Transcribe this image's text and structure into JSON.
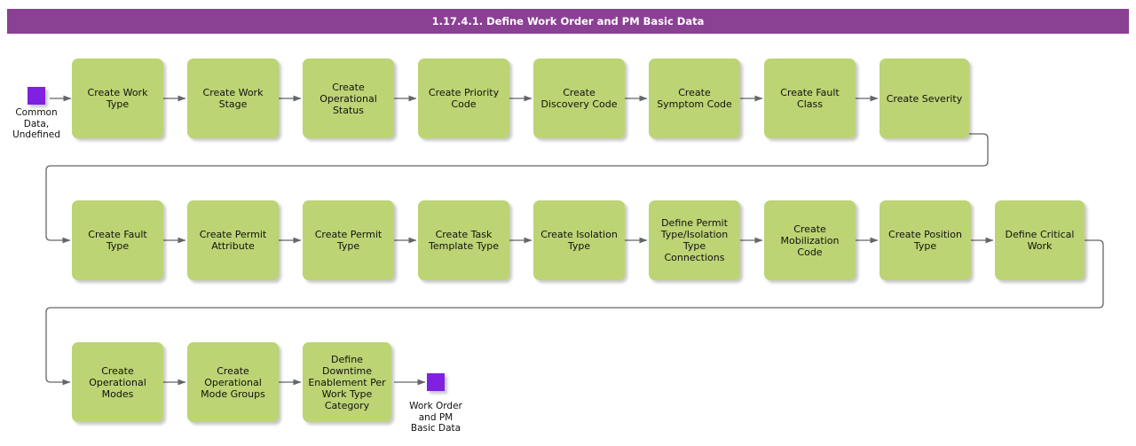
{
  "header": {
    "title": "1.17.4.1. Define Work Order and PM Basic Data",
    "bar_color": "#8a4093",
    "text_color": "#ffffff"
  },
  "palette": {
    "node_fill": "#bcd474",
    "node_text": "#12100e",
    "terminator_fill": "#8020e0",
    "connector": "#63666a",
    "canvas": "#ffffff"
  },
  "start_node": {
    "name": "start-terminator",
    "label": "Common\nData,\nUndefined"
  },
  "end_node": {
    "name": "end-terminator",
    "label": "Work Order\nand PM\nBasic Data"
  },
  "rows": [
    {
      "row": 1,
      "nodes": [
        {
          "id": "create-work-type",
          "label": "Create Work\nType"
        },
        {
          "id": "create-work-stage",
          "label": "Create Work\nStage"
        },
        {
          "id": "create-operational-status",
          "label": "Create\nOperational\nStatus"
        },
        {
          "id": "create-priority-code",
          "label": "Create Priority\nCode"
        },
        {
          "id": "create-discovery-code",
          "label": "Create\nDiscovery Code"
        },
        {
          "id": "create-symptom-code",
          "label": "Create\nSymptom Code"
        },
        {
          "id": "create-fault-class",
          "label": "Create Fault\nClass"
        },
        {
          "id": "create-severity",
          "label": "Create Severity"
        }
      ]
    },
    {
      "row": 2,
      "nodes": [
        {
          "id": "create-fault-type",
          "label": "Create Fault\nType"
        },
        {
          "id": "create-permit-attribute",
          "label": "Create Permit\nAttribute"
        },
        {
          "id": "create-permit-type",
          "label": "Create Permit\nType"
        },
        {
          "id": "create-task-template-type",
          "label": "Create Task\nTemplate Type"
        },
        {
          "id": "create-isolation-type",
          "label": "Create Isolation\nType"
        },
        {
          "id": "define-permit-type-isolation-type-connections",
          "label": "Define Permit\nType/Isolation\nType\nConnections"
        },
        {
          "id": "create-mobilization-code",
          "label": "Create\nMobilization\nCode"
        },
        {
          "id": "create-position-type",
          "label": "Create Position\nType"
        },
        {
          "id": "define-critical-work",
          "label": "Define Critical\nWork"
        }
      ]
    },
    {
      "row": 3,
      "nodes": [
        {
          "id": "create-operational-modes",
          "label": "Create\nOperational\nModes"
        },
        {
          "id": "create-operational-mode-groups",
          "label": "Create\nOperational\nMode Groups"
        },
        {
          "id": "define-downtime-enablement-per-work-type-category",
          "label": "Define\nDowntime\nEnablement Per\nWork Type\nCategory"
        }
      ]
    }
  ]
}
